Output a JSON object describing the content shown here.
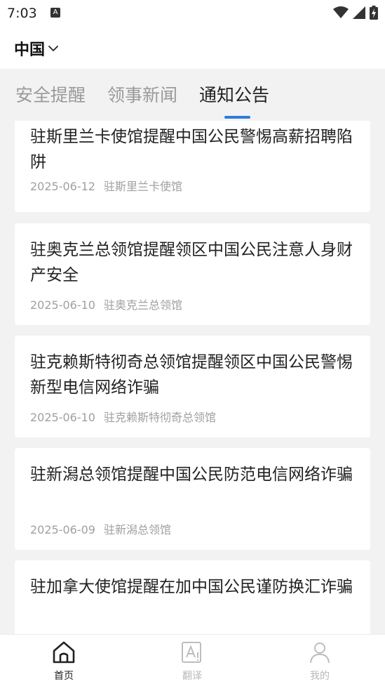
{
  "status_bar": {
    "time": "7:03",
    "notification_icon": "A"
  },
  "region": {
    "label": "中国",
    "icon": "chevron-down-icon"
  },
  "tabs": [
    {
      "label": "安全提醒",
      "active": false
    },
    {
      "label": "领事新闻",
      "active": false
    },
    {
      "label": "通知公告",
      "active": true
    }
  ],
  "articles": [
    {
      "title": "驻斯里兰卡使馆提醒中国公民警惕高薪招聘陷阱",
      "date": "2025-06-12",
      "source": "驻斯里兰卡使馆"
    },
    {
      "title": "驻奥克兰总领馆提醒领区中国公民注意人身财产安全",
      "date": "2025-06-10",
      "source": "驻奥克兰总领馆"
    },
    {
      "title": "驻克赖斯特彻奇总领馆提醒领区中国公民警惕新型电信网络诈骗",
      "date": "2025-06-10",
      "source": "驻克赖斯特彻奇总领馆"
    },
    {
      "title": "驻新潟总领馆提醒中国公民防范电信网络诈骗",
      "date": "2025-06-09",
      "source": "驻新潟总领馆"
    },
    {
      "title": "驻加拿大使馆提醒在加中国公民谨防换汇诈骗",
      "date": "",
      "source": ""
    }
  ],
  "bottom_nav": [
    {
      "label": "首页",
      "icon": "home-icon",
      "active": true
    },
    {
      "label": "翻译",
      "icon": "translate-icon",
      "active": false
    },
    {
      "label": "我的",
      "icon": "profile-icon",
      "active": false
    }
  ],
  "colors": {
    "accent": "#2e7bd8",
    "background": "#f2f2f2",
    "inactive": "#9a9a9a"
  }
}
